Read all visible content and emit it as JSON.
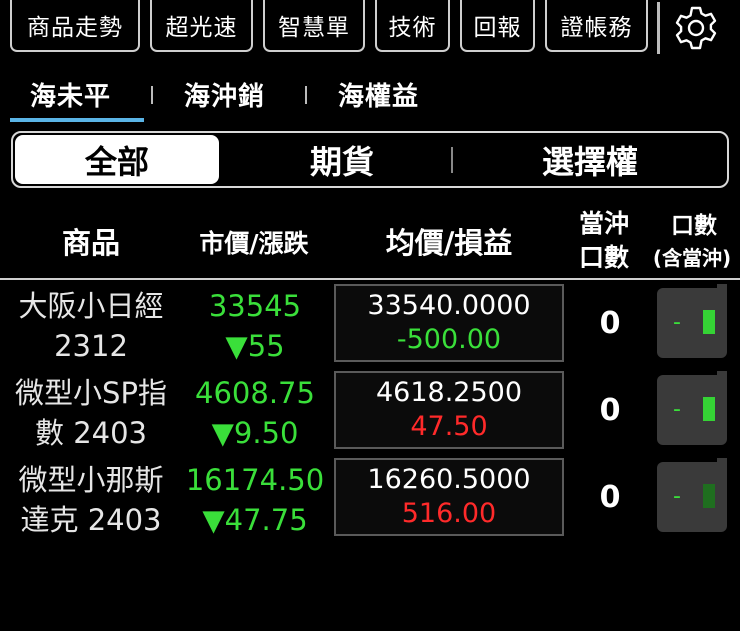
{
  "toolbar": {
    "buttons": [
      "商品走勢",
      "超光速",
      "智慧單",
      "技術",
      "回報",
      "證帳務"
    ]
  },
  "account_tabs": [
    "海未平",
    "海沖銷",
    "海權益"
  ],
  "segment": [
    "全部",
    "期貨",
    "選擇權"
  ],
  "table_header": {
    "product": "商品",
    "price_change": "市價/漲跌",
    "avg_pnl": "均價/損益",
    "day_lots_1": "當沖",
    "day_lots_2": "口數",
    "lots_1": "口數",
    "lots_2": "(含當沖)"
  },
  "rows": [
    {
      "name_line1": "大阪小日經",
      "name_line2": "2312",
      "price": "33545",
      "change": "▼55",
      "avg": "33540.0000",
      "pnl": "-500.00",
      "pnl_sign": "neg",
      "day_lots": "0",
      "lots": "-"
    },
    {
      "name_line1": "微型小SP指",
      "name_line2": "數 2403",
      "price": "4608.75",
      "change": "▼9.50",
      "avg": "4618.2500",
      "pnl": "47.50",
      "pnl_sign": "pos",
      "day_lots": "0",
      "lots": "-"
    },
    {
      "name_line1": "微型小那斯",
      "name_line2": "達克 2403",
      "price": "16174.50",
      "change": "▼47.75",
      "avg": "16260.5000",
      "pnl": "516.00",
      "pnl_sign": "pos",
      "day_lots": "0",
      "lots": "-"
    }
  ],
  "colors": {
    "down": "#3adf3a",
    "profit": "#ff2a2a",
    "tab_underline": "#5ab4e6"
  },
  "icons": {
    "settings": "gear-icon"
  }
}
